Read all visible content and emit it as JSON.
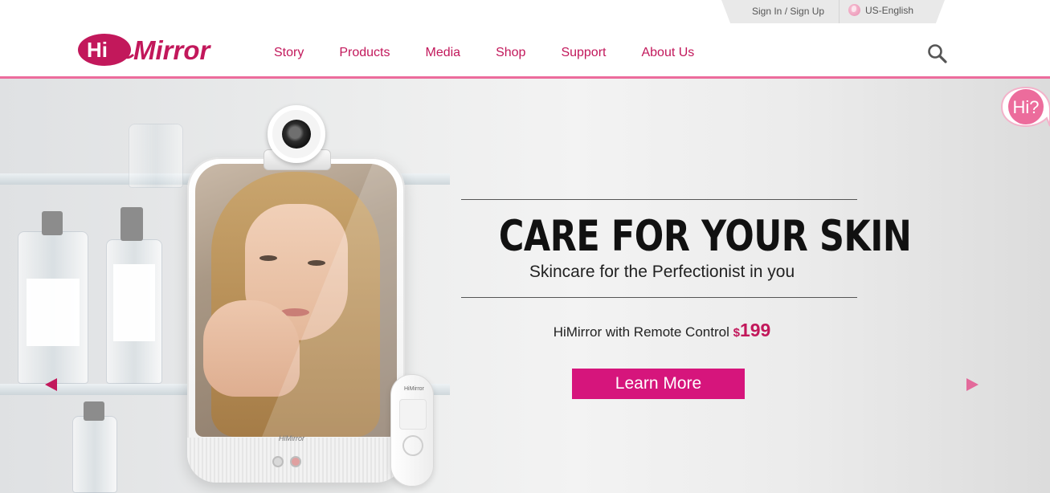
{
  "utility": {
    "signin_label": "Sign In / Sign Up",
    "language_label": "US-English"
  },
  "brand": {
    "logo_hi": "Hi",
    "logo_mirror": "Mirror",
    "accent_color": "#c2185b",
    "cta_color": "#d6157c",
    "rule_color": "#ec6c9c"
  },
  "nav": {
    "items": [
      {
        "label": "Story"
      },
      {
        "label": "Products"
      },
      {
        "label": "Media"
      },
      {
        "label": "Shop"
      },
      {
        "label": "Support"
      },
      {
        "label": "About Us"
      }
    ],
    "search_icon": "search-icon"
  },
  "hero": {
    "title": "CARE FOR YOUR SKIN",
    "subtitle": "Skincare for the Perfectionist in you",
    "promo_text": "HiMirror with Remote Control",
    "price_symbol": "$",
    "price": "199",
    "cta_label": "Learn More",
    "prev_icon": "chevron-left-icon",
    "next_icon": "chevron-right-icon",
    "mirror_brand": "HiMirror",
    "remote_brand": "HiMirror"
  },
  "chat": {
    "label": "Hi?"
  }
}
